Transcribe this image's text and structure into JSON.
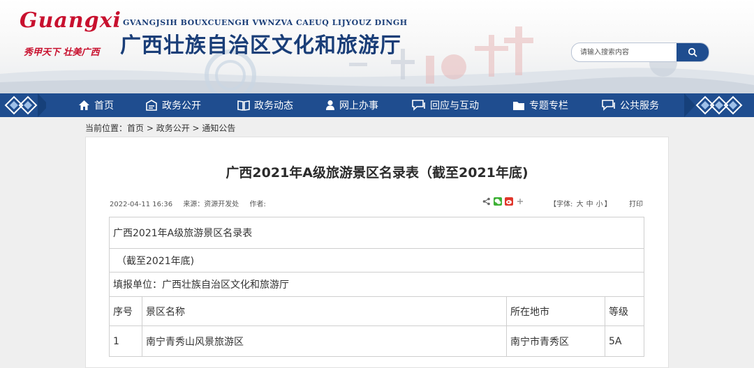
{
  "header": {
    "logo_text": "Guangxi",
    "slogan": "秀甲天下 壮美广西",
    "zhuang_name": "GVANGJSIH BOUXCUENGH VWNZVA CAEUQ LIJYOUZ DINGH",
    "site_title": "广西壮族自治区文化和旅游厅",
    "search_placeholder": "请输入搜索内容"
  },
  "nav": {
    "items": [
      {
        "label": "首页",
        "icon": "home-icon"
      },
      {
        "label": "政务公开",
        "icon": "open-icon"
      },
      {
        "label": "政务动态",
        "icon": "book-icon"
      },
      {
        "label": "网上办事",
        "icon": "person-icon"
      },
      {
        "label": "回应与互动",
        "icon": "chat-icon"
      },
      {
        "label": "专题专栏",
        "icon": "folder-icon"
      },
      {
        "label": "公共服务",
        "icon": "service-icon"
      }
    ]
  },
  "breadcrumb": {
    "prefix": "当前位置：",
    "items": [
      "首页",
      "政务公开",
      "通知公告"
    ],
    "sep": " > "
  },
  "article": {
    "title": "广西2021年A级旅游景区名录表（截至2021年底)",
    "date": "2022-04-11 16:36",
    "source": "来源：资源开发处",
    "author": "作者:",
    "font_label_prefix": "【字体:",
    "font_sizes": [
      "大",
      "中",
      "小"
    ],
    "font_label_suffix": "】",
    "print_label": "打印",
    "share_icons": [
      "share-icon",
      "wechat-icon",
      "weibo-icon",
      "plus-icon"
    ]
  },
  "table": {
    "caption": "广西2021年A级旅游景区名录表",
    "subtitle": "（截至2021年底)",
    "unit": "填报单位：广西壮族自治区文化和旅游厅",
    "headers": [
      "序号",
      "景区名称",
      "所在地市",
      "等级"
    ],
    "rows": [
      [
        "1",
        "南宁青秀山风景旅游区",
        "南宁市青秀区",
        "5A"
      ]
    ]
  },
  "colors": {
    "nav_blue": "#1f4d8f",
    "brand_red": "#c8102e",
    "title_blue": "#1a3e78"
  }
}
